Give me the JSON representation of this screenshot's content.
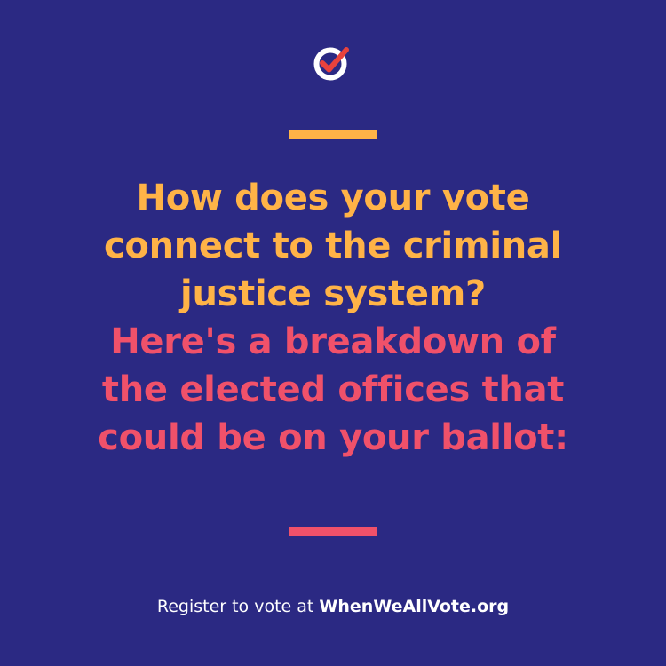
{
  "branding": {
    "logo_icon": "checkmark-circle-icon",
    "background_color": "#2b2983",
    "accent_yellow": "#ffb347",
    "accent_pink": "#f0516a",
    "logo_check_color": "#e8423d"
  },
  "headline": {
    "question_lines": [
      "How does your vote",
      "connect to the criminal",
      "justice system?"
    ],
    "answer_lines": [
      "Here's a breakdown of",
      "the elected offices that",
      "could be on your ballot:"
    ]
  },
  "footer": {
    "text": "Register to vote at",
    "site": "WhenWeAllVote.org"
  }
}
